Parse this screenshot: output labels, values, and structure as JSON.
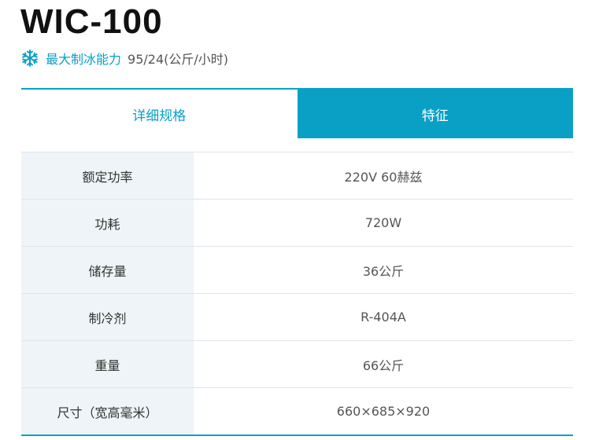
{
  "product": {
    "title": "WIC-100"
  },
  "capacity": {
    "icon": "snowflake-icon",
    "label": "最大制冰能力",
    "value": "95/24(公斤/小时)"
  },
  "tabs": [
    {
      "label": "详细规格",
      "active": false
    },
    {
      "label": "特征",
      "active": true
    }
  ],
  "specs": [
    {
      "key": "额定功率",
      "value": "220V 60赫兹"
    },
    {
      "key": "功耗",
      "value": "720W"
    },
    {
      "key": "储存量",
      "value": "36公斤"
    },
    {
      "key": "制冷剂",
      "value": "R-404A"
    },
    {
      "key": "重量",
      "value": "66公斤"
    },
    {
      "key": "尺寸（宽高毫米）",
      "value": "660×685×920"
    }
  ],
  "colors": {
    "accent": "#0aa0c6",
    "row_key_bg": "#eef4f7",
    "border": "#dfe5e8"
  }
}
